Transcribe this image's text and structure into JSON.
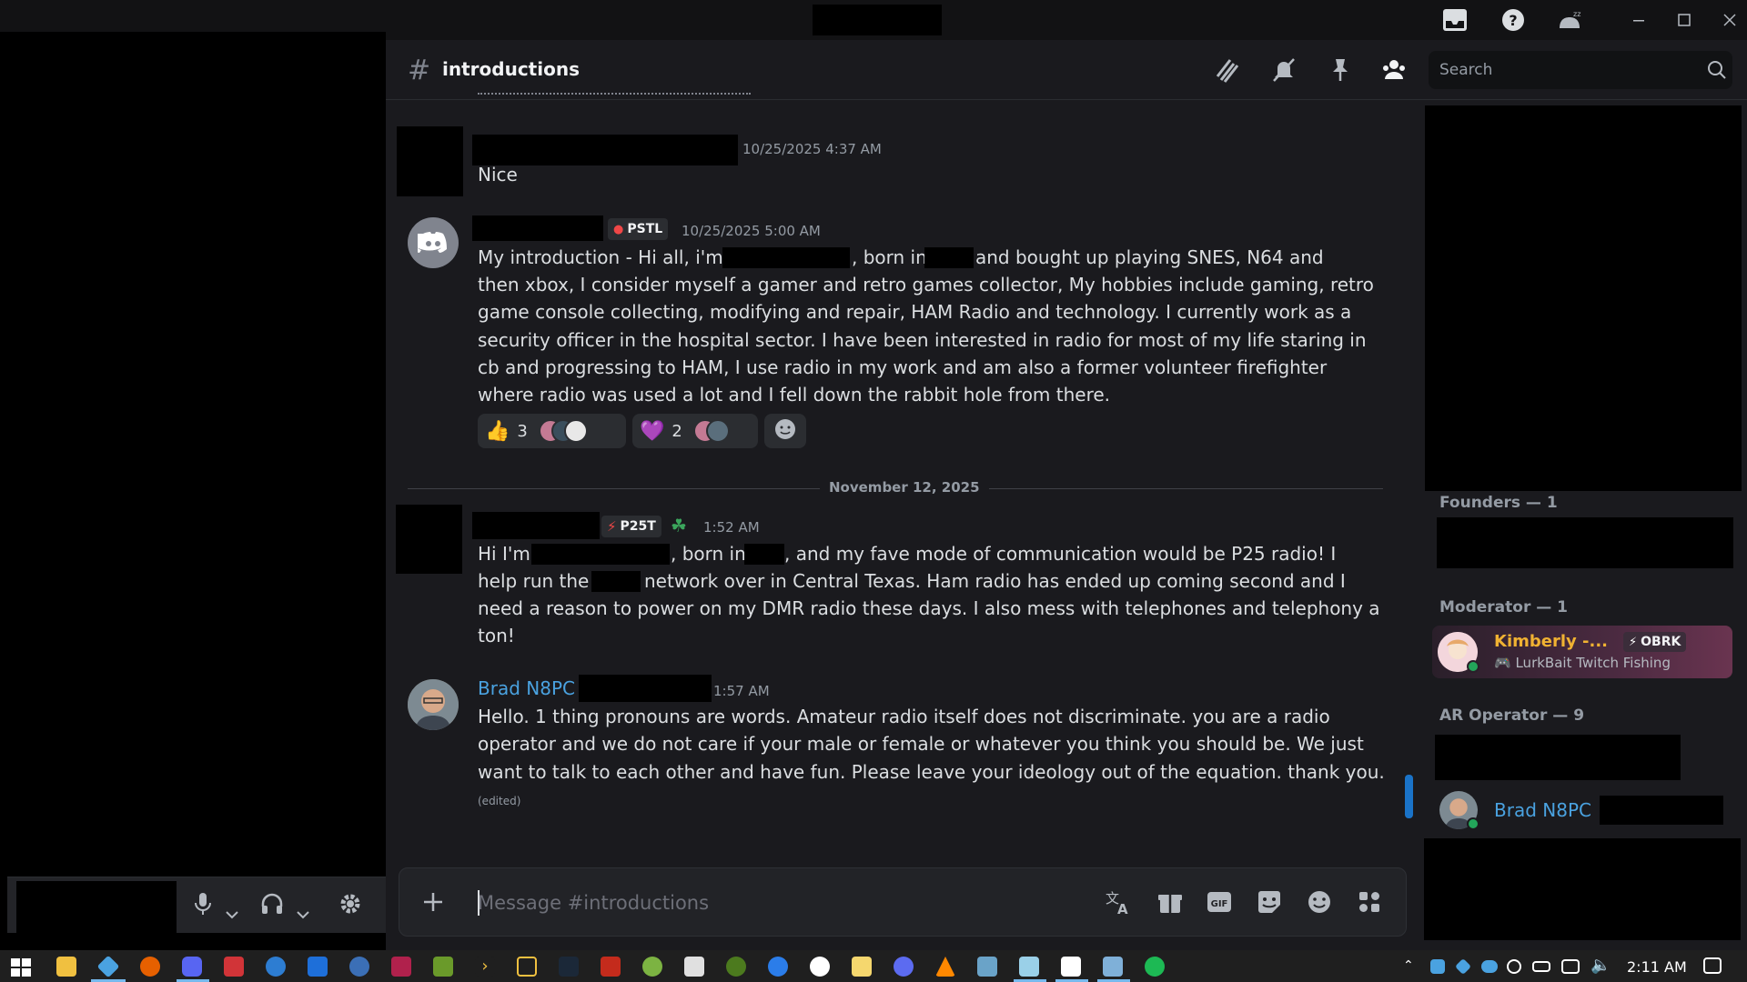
{
  "app": {
    "colors": {
      "background": "#1a1a1e",
      "link_blue": "#4aa2e0",
      "online_green": "#23a55a",
      "scroll_blue": "#1a73c8"
    }
  },
  "header": {
    "channel": "introductions",
    "icons": [
      "threads-icon",
      "notification-muted-icon",
      "pin-icon",
      "member-list-icon"
    ],
    "search_placeholder": "Search"
  },
  "messages": [
    {
      "timestamp": "10/25/2025 4:37 AM",
      "text": "Nice"
    },
    {
      "tag": "PSTL",
      "timestamp": "10/25/2025 5:00 AM",
      "lines": [
        "My introduction - Hi all, i'm",
        ", born in",
        "and bought up playing SNES, N64 and",
        "then xbox, I consider myself a gamer and retro games collector, My hobbies include gaming, retro",
        "game console collecting, modifying and repair, HAM Radio and technology. I currently work as a",
        "security officer in the hospital sector. I have been interested in radio for most of my life staring in",
        "cb and progressing to HAM, I use radio in my work and am also a former volunteer firefighter",
        "where radio was used a lot and I fell down the rabbit hole from there."
      ],
      "reactions": [
        {
          "emoji": "👍",
          "count": "3"
        },
        {
          "emoji": "💜",
          "count": "2"
        }
      ]
    },
    {
      "divider": "November 12, 2025"
    },
    {
      "tag": "P25T",
      "timestamp": "1:52 AM",
      "lines": [
        "Hi I'm",
        ", born in",
        ", and my fave mode of communication would be P25 radio! I",
        "help run the",
        "network over in Central Texas. Ham radio has ended up coming second and I",
        "need a reason to power on my DMR radio these days. I also mess with telephones and telephony a",
        "ton!"
      ]
    },
    {
      "author": "Brad N8PC",
      "timestamp": "1:57 AM",
      "lines": [
        "Hello.  1 thing pronouns are words. Amateur radio itself does not discriminate. you are a radio",
        "operator and we do not care if your male or female or whatever you think you should be. We just",
        "want to talk to each other and have fun. Please leave your ideology out of the equation. thank you."
      ],
      "edited": "(edited)"
    }
  ],
  "composer": {
    "placeholder": "Message #introductions"
  },
  "members": {
    "roles": [
      {
        "label": "Founders — 1"
      },
      {
        "label": "Moderator — 1"
      },
      {
        "label": "AR Operator — 9"
      }
    ],
    "moderator": {
      "name": "Kimberly -...",
      "tag": "OBRK",
      "activity": "LurkBait Twitch Fishing"
    },
    "operator": {
      "name": "Brad N8PC"
    }
  },
  "taskbar": {
    "time": "2:11 AM"
  }
}
